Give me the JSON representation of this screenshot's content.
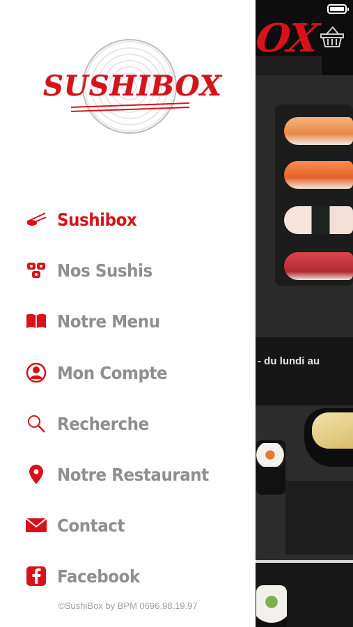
{
  "app": {
    "name": "SushiBox"
  },
  "drawer": {
    "logo_text": "SUSHIBOX",
    "menu": [
      {
        "label": "Sushibox",
        "icon": "sushi-chopsticks-icon",
        "active": true
      },
      {
        "label": "Nos Sushis",
        "icon": "sushi-rolls-icon",
        "active": false
      },
      {
        "label": "Notre Menu",
        "icon": "book-icon",
        "active": false
      },
      {
        "label": "Mon Compte",
        "icon": "user-icon",
        "active": false
      },
      {
        "label": "Recherche",
        "icon": "search-icon",
        "active": false
      },
      {
        "label": "Notre Restaurant",
        "icon": "map-pin-icon",
        "active": false
      },
      {
        "label": "Contact",
        "icon": "envelope-icon",
        "active": false
      },
      {
        "label": "Facebook",
        "icon": "facebook-icon",
        "active": false
      }
    ],
    "footer": "©SushiBox by BPM 0696.98.19.97"
  },
  "background": {
    "header_logo_fragment": "OX",
    "hours_text": "- du lundi au"
  },
  "colors": {
    "accent": "#d8121b",
    "menu_text": "#8f8f8f",
    "drawer_bg": "#ffffff"
  }
}
